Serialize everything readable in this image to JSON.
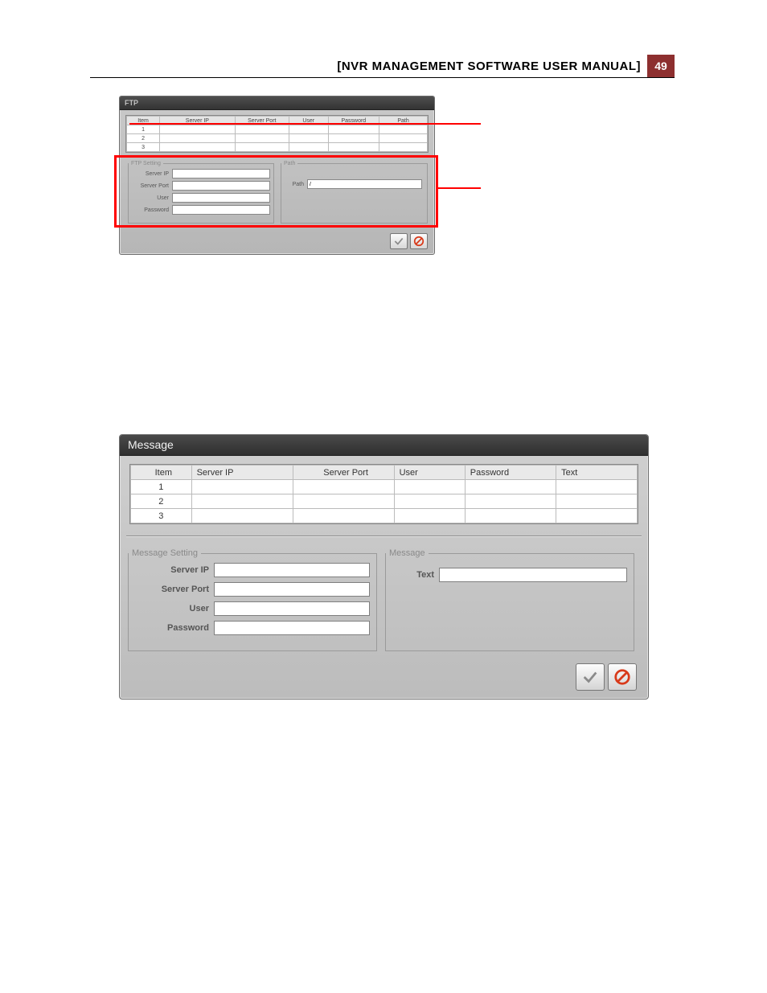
{
  "page": {
    "title": "[NVR MANAGEMENT SOFTWARE USER MANUAL]",
    "number": "49"
  },
  "ftp": {
    "title": "FTP",
    "table": {
      "headers": [
        "Item",
        "Server IP",
        "Server Port",
        "User",
        "Password",
        "Path"
      ],
      "rows": [
        {
          "item": "1",
          "server_ip": "",
          "server_port": "",
          "user": "",
          "password": "",
          "path": ""
        },
        {
          "item": "2",
          "server_ip": "",
          "server_port": "",
          "user": "",
          "password": "",
          "path": ""
        },
        {
          "item": "3",
          "server_ip": "",
          "server_port": "",
          "user": "",
          "password": "",
          "path": ""
        }
      ]
    },
    "setting": {
      "legend": "FTP Setting",
      "server_ip_label": "Server IP",
      "server_ip_value": "",
      "server_port_label": "Server Port",
      "server_port_value": "",
      "user_label": "User",
      "user_value": "",
      "password_label": "Password",
      "password_value": ""
    },
    "path": {
      "legend": "Path",
      "path_label": "Path",
      "path_value": "/"
    }
  },
  "message": {
    "title": "Message",
    "table": {
      "headers": [
        "Item",
        "Server IP",
        "Server Port",
        "User",
        "Password",
        "Text"
      ],
      "rows": [
        {
          "item": "1",
          "server_ip": "",
          "server_port": "",
          "user": "",
          "password": "",
          "text": ""
        },
        {
          "item": "2",
          "server_ip": "",
          "server_port": "",
          "user": "",
          "password": "",
          "text": ""
        },
        {
          "item": "3",
          "server_ip": "",
          "server_port": "",
          "user": "",
          "password": "",
          "text": ""
        }
      ]
    },
    "setting": {
      "legend": "Message Setting",
      "server_ip_label": "Server IP",
      "server_ip_value": "",
      "server_port_label": "Server Port",
      "server_port_value": "",
      "user_label": "User",
      "user_value": "",
      "password_label": "Password",
      "password_value": ""
    },
    "text": {
      "legend": "Message",
      "text_label": "Text",
      "text_value": ""
    }
  }
}
